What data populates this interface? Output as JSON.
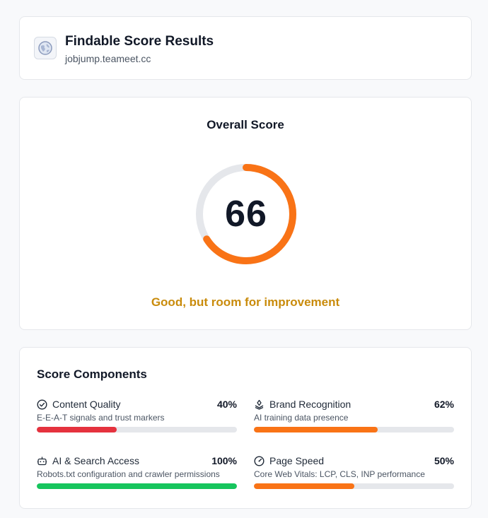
{
  "header": {
    "title": "Findable Score Results",
    "domain": "jobjump.teameet.cc",
    "icon": "globe-icon"
  },
  "overall": {
    "title": "Overall Score",
    "score": 66,
    "score_label": "66",
    "max": 100,
    "status": "Good, but room for improvement",
    "colors": {
      "ring": "#f97316",
      "track": "#e5e7eb",
      "status": "#c98b0b"
    }
  },
  "components": {
    "title": "Score Components",
    "items": [
      {
        "label": "Content Quality",
        "value": "40%",
        "fraction": 0.4,
        "description": "E-E-A-T signals and trust markers",
        "color": "#e5323e",
        "icon": "check-circle-icon"
      },
      {
        "label": "Brand Recognition",
        "value": "62%",
        "fraction": 0.62,
        "description": "AI training data presence",
        "color": "#f97316",
        "icon": "brand-stack-icon"
      },
      {
        "label": "AI & Search Access",
        "value": "100%",
        "fraction": 1.0,
        "description": "Robots.txt configuration and crawler permissions",
        "color": "#16c55d",
        "icon": "robot-icon"
      },
      {
        "label": "Page Speed",
        "value": "50%",
        "fraction": 0.5,
        "description": "Core Web Vitals: LCP, CLS, INP performance",
        "color": "#f97316",
        "icon": "gauge-icon"
      }
    ]
  }
}
